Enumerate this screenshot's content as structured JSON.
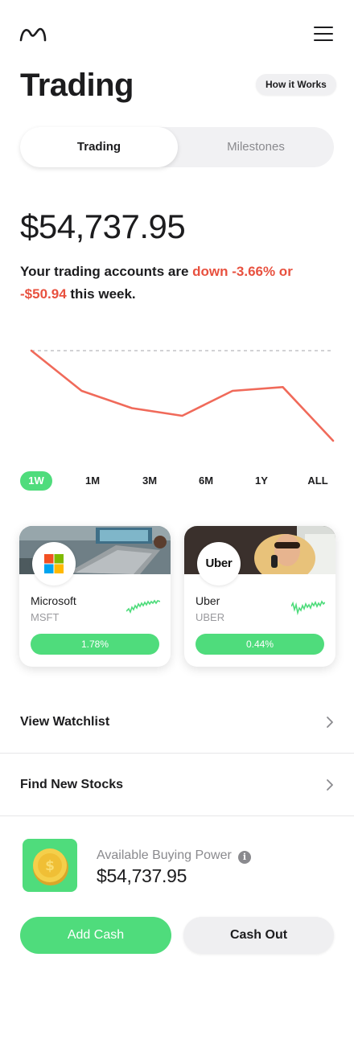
{
  "header": {
    "logo_icon": "wave-logo-icon",
    "menu_icon": "hamburger-menu-icon",
    "title": "Trading",
    "how_it_works": "How it Works"
  },
  "tabs": [
    {
      "label": "Trading",
      "active": true
    },
    {
      "label": "Milestones",
      "active": false
    }
  ],
  "portfolio": {
    "balance": "$54,737.95",
    "summary_prefix": "Your trading accounts are ",
    "summary_change": "down -3.66% or -$50.94",
    "summary_suffix": " this week."
  },
  "chart_data": {
    "type": "line",
    "values": [
      100,
      97.9,
      97.0,
      96.6,
      97.9,
      98.1,
      95.3
    ],
    "baseline": 100,
    "line_color": "#f06a5a",
    "baseline_style": "dashed"
  },
  "ranges": [
    "1W",
    "1M",
    "3M",
    "6M",
    "1Y",
    "ALL"
  ],
  "active_range": "1W",
  "stocks": [
    {
      "name": "Microsoft",
      "ticker": "MSFT",
      "change": "1.78%",
      "logo_icon": "microsoft-logo-icon"
    },
    {
      "name": "Uber",
      "ticker": "UBER",
      "change": "0.44%",
      "logo_text": "Uber"
    }
  ],
  "links": {
    "watchlist": "View Watchlist",
    "find_stocks": "Find New Stocks"
  },
  "buying_power": {
    "label": "Available Buying Power",
    "info_icon": "i",
    "value": "$54,737.95"
  },
  "actions": {
    "add_cash": "Add Cash",
    "cash_out": "Cash Out"
  },
  "colors": {
    "accent_green": "#4fdc7c",
    "negative_red": "#e8513f",
    "text_dark": "#1c1c1e",
    "text_muted": "#8a8a8e"
  }
}
